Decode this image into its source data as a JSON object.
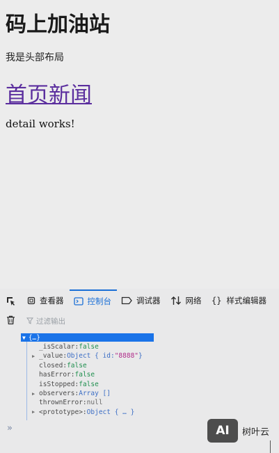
{
  "page": {
    "site_title": "码上加油站",
    "header_text": "我是头部布局",
    "news_link": "首页新闻",
    "detail_text": "detail works!"
  },
  "devtools": {
    "tabs": [
      {
        "label": "",
        "icon": "element-picker-icon"
      },
      {
        "label": "查看器",
        "icon": "inspector-icon"
      },
      {
        "label": "控制台",
        "icon": "console-icon",
        "active": true
      },
      {
        "label": "调试器",
        "icon": "debugger-icon"
      },
      {
        "label": "网络",
        "icon": "network-icon"
      },
      {
        "label": "样式编辑器",
        "icon": "style-editor-icon"
      }
    ],
    "filter_placeholder": "过滤输出",
    "console": {
      "root": "{…}",
      "rows": [
        {
          "key": "_isScalar",
          "sep": ": ",
          "value": "false",
          "type": "bool",
          "expandable": false
        },
        {
          "key": "_value",
          "sep": ": ",
          "value": "Object { id: ",
          "value2": "\"8888\"",
          "value3": " }",
          "type": "obj",
          "expandable": true
        },
        {
          "key": "closed",
          "sep": ": ",
          "value": "false",
          "type": "bool",
          "expandable": false
        },
        {
          "key": "hasError",
          "sep": ": ",
          "value": "false",
          "type": "bool",
          "expandable": false
        },
        {
          "key": "isStopped",
          "sep": ": ",
          "value": "false",
          "type": "bool",
          "expandable": false
        },
        {
          "key": "observers",
          "sep": ": ",
          "value": "Array []",
          "type": "obj",
          "expandable": true
        },
        {
          "key": "thrownError",
          "sep": ": ",
          "value": "null",
          "type": "null",
          "expandable": false
        },
        {
          "key": "<prototype>",
          "sep": ": ",
          "value": "Object { … }",
          "type": "obj",
          "expandable": true
        }
      ]
    },
    "prompt": "»",
    "watermark_logo": "AI",
    "watermark_text": "树叶云"
  },
  "colors": {
    "accent": "#1a6fd6",
    "link": "#5b2e9e",
    "bool": "#1f8f4e",
    "string": "#b02c8a"
  }
}
